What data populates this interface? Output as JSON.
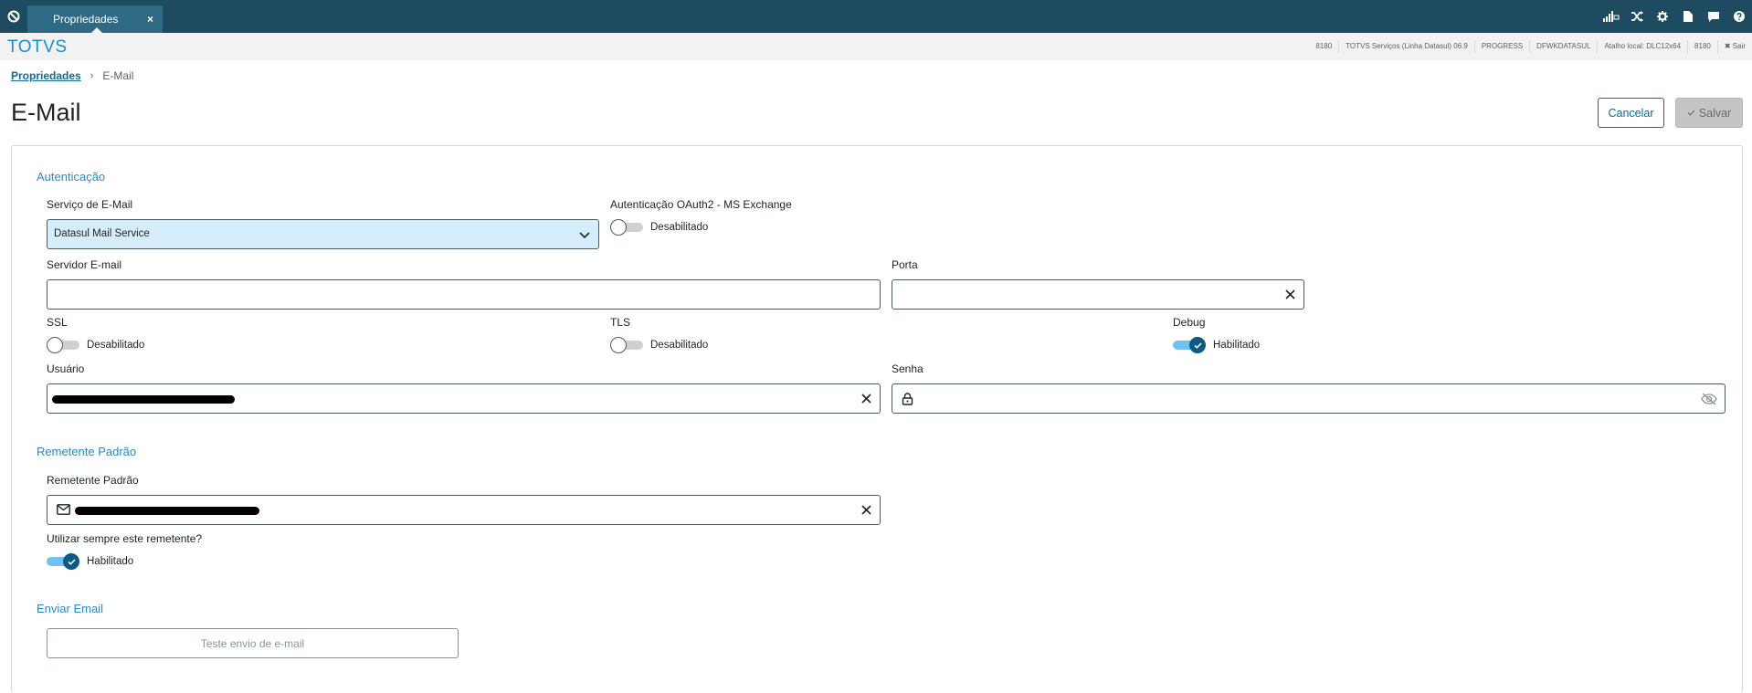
{
  "topbar": {
    "tab_label": "Propriedades",
    "tab_close": "×",
    "tools": [
      "signal-icon",
      "shuffle-icon",
      "gear-icon",
      "document-icon",
      "chat-icon",
      "help-icon"
    ]
  },
  "infobar": {
    "brand": "TOTVS",
    "items": [
      "8180",
      "TOTVS Serviços (Linha Datasul) 06.9",
      "PROGRESS",
      "DFWKDATASUL",
      "Atalho local: DLC12x64",
      "8180"
    ],
    "logout": "✖ Sair"
  },
  "breadcrumb": {
    "link": "Propriedades",
    "separator": "›",
    "current": "E-Mail"
  },
  "page": {
    "title": "E-Mail"
  },
  "actions": {
    "cancel": "Cancelar",
    "save": "Salvar"
  },
  "auth": {
    "section": "Autenticação",
    "service_label": "Serviço de E-Mail",
    "service_value": "Datasul Mail Service",
    "oauth_label": "Autenticação OAuth2 - MS Exchange",
    "oauth_state": "Desabilitado",
    "server_label": "Servidor E-mail",
    "port_label": "Porta",
    "ssl_label": "SSL",
    "ssl_state": "Desabilitado",
    "tls_label": "TLS",
    "tls_state": "Desabilitado",
    "debug_label": "Debug",
    "debug_state": "Habilitado",
    "user_label": "Usuário",
    "password_label": "Senha"
  },
  "sender": {
    "section": "Remetente Padrão",
    "field_label": "Remetente Padrão",
    "always_label": "Utilizar sempre este remetente?",
    "always_state": "Habilitado"
  },
  "send": {
    "section": "Enviar Email",
    "test_button": "Teste envio de e-mail"
  },
  "colors": {
    "topbar": "#1e4b5f",
    "accent": "#0c6c94",
    "section": "#2a8ac4",
    "toggle_on": "#0c5a86"
  }
}
